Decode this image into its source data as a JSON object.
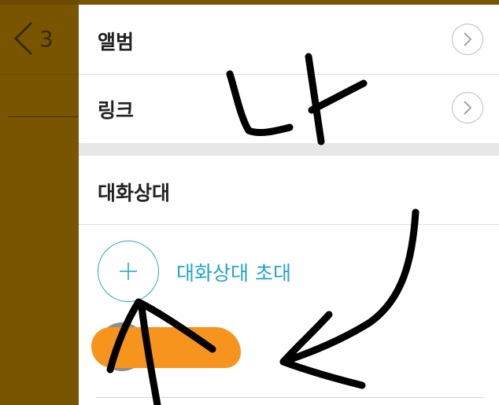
{
  "header": {
    "back_count": "3"
  },
  "menu": {
    "album_label": "앨범",
    "link_label": "링크"
  },
  "members": {
    "section_title": "대화상대",
    "invite_label": "대화상대 초대"
  },
  "annotations": {
    "handwriting": "나"
  },
  "colors": {
    "dim_background": "#7a5500",
    "accent": "#21a6c3",
    "redaction": "#f7941d",
    "ink": "#000000"
  },
  "icons": [
    "back-chevron-icon",
    "chevron-right-icon",
    "plus-icon"
  ]
}
